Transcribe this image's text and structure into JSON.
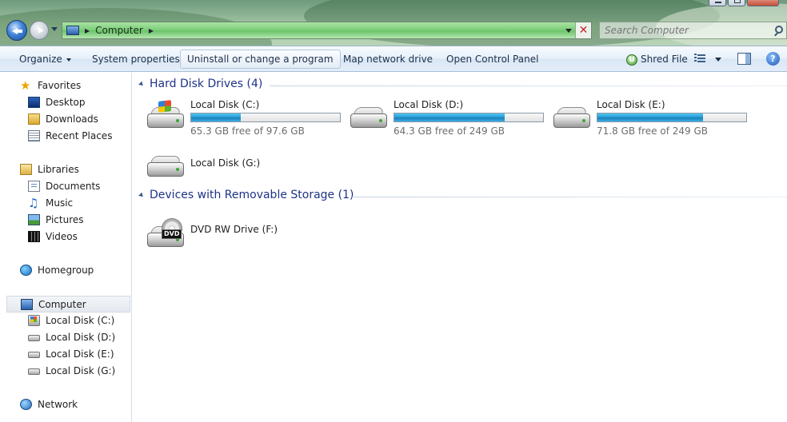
{
  "window": {
    "controls": [
      "minimize",
      "maximize",
      "close"
    ]
  },
  "address": {
    "crumb": "Computer"
  },
  "search": {
    "placeholder": "Search Computer"
  },
  "toolbar": {
    "organize": "Organize",
    "system_properties": "System properties",
    "uninstall": "Uninstall or change a program",
    "map_drive": "Map network drive",
    "control_panel": "Open Control Panel",
    "shred": "Shred File"
  },
  "nav": {
    "favorites": {
      "label": "Favorites",
      "icon": "star-icon"
    },
    "desktop": {
      "label": "Desktop",
      "icon": "desktop-icon"
    },
    "downloads": {
      "label": "Downloads",
      "icon": "downloads-folder-icon"
    },
    "recent": {
      "label": "Recent Places",
      "icon": "recent-places-icon"
    },
    "libraries": {
      "label": "Libraries",
      "icon": "libraries-icon"
    },
    "documents": {
      "label": "Documents",
      "icon": "documents-icon"
    },
    "music": {
      "label": "Music",
      "icon": "music-icon"
    },
    "pictures": {
      "label": "Pictures",
      "icon": "pictures-icon"
    },
    "videos": {
      "label": "Videos",
      "icon": "videos-icon"
    },
    "homegroup": {
      "label": "Homegroup",
      "icon": "homegroup-icon"
    },
    "computer": {
      "label": "Computer",
      "icon": "computer-icon"
    },
    "disk_c": {
      "label": "Local Disk (C:)",
      "icon": "system-drive-icon"
    },
    "disk_d": {
      "label": "Local Disk (D:)",
      "icon": "drive-icon"
    },
    "disk_e": {
      "label": "Local Disk (E:)",
      "icon": "drive-icon"
    },
    "disk_g": {
      "label": "Local Disk (G:)",
      "icon": "drive-icon"
    },
    "network": {
      "label": "Network",
      "icon": "network-icon"
    }
  },
  "groups": {
    "hard_disks": "Hard Disk Drives (4)",
    "removable": "Devices with Removable Storage (1)"
  },
  "drives": {
    "c": {
      "name": "Local Disk (C:)",
      "free": "65.3 GB free of 97.6 GB",
      "used_fraction": 0.331
    },
    "d": {
      "name": "Local Disk (D:)",
      "free": "64.3 GB free of 249 GB",
      "used_fraction": 0.742
    },
    "e": {
      "name": "Local Disk (E:)",
      "free": "71.8 GB free of 249 GB",
      "used_fraction": 0.712
    },
    "g": {
      "name": "Local Disk (G:)"
    },
    "dvd": {
      "name": "DVD RW Drive (F:)",
      "badge": "DVD"
    }
  },
  "colors": {
    "group_heading": "#1e3287",
    "capacity_bar": "#26a0da",
    "address_bar": "#7fcf7b"
  }
}
